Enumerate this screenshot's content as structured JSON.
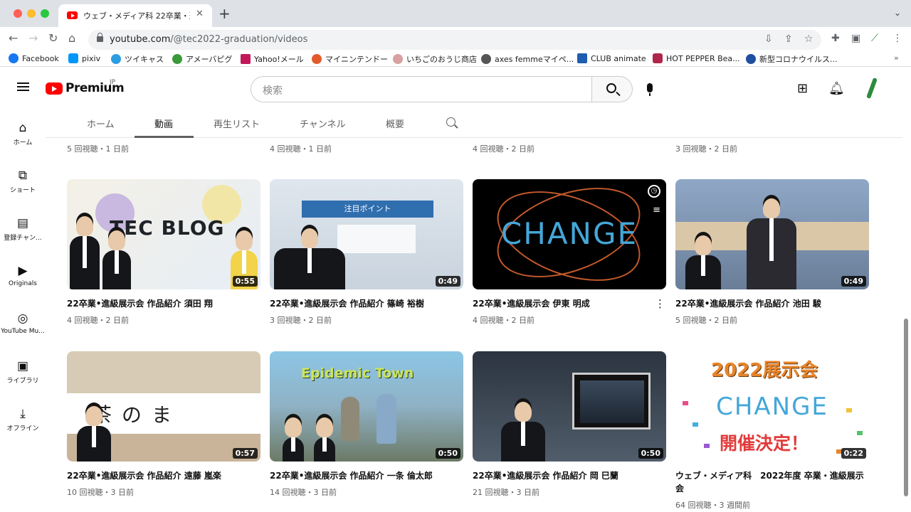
{
  "browser": {
    "tab_title": "ウェブ・メディア科 22卒業・進級",
    "url_host": "youtube.com",
    "url_path": "/@tec2022-graduation/videos",
    "bookmarks": [
      {
        "label": "Facebook",
        "color": "#1877f2"
      },
      {
        "label": "pixiv",
        "color": "#0096fa"
      },
      {
        "label": "ツイキャス",
        "color": "#2d9de3"
      },
      {
        "label": "アメーバピグ",
        "color": "#3a9a3a"
      },
      {
        "label": "Yahoo!メール",
        "color": "#c2185b"
      },
      {
        "label": "マイニンテンドー",
        "color": "#e35a2a"
      },
      {
        "label": "いちごのおうじ商店",
        "color": "#d9a0a0"
      },
      {
        "label": "axes femmeマイペ...",
        "color": "#555555"
      },
      {
        "label": "CLUB animate",
        "color": "#1e5eb0"
      },
      {
        "label": "HOT PEPPER Bea...",
        "color": "#b0264a"
      },
      {
        "label": "新型コロナウイルス...",
        "color": "#1e4fa0"
      }
    ]
  },
  "youtube": {
    "logo_text": "Premium",
    "logo_region": "JP",
    "search_placeholder": "検索",
    "sidebar": [
      {
        "label": "ホーム",
        "icon": "home-icon"
      },
      {
        "label": "ショート",
        "icon": "shorts-icon"
      },
      {
        "label": "登録チャン...",
        "icon": "subscriptions-icon"
      },
      {
        "label": "Originals",
        "icon": "originals-icon"
      },
      {
        "label": "YouTube Mu...",
        "icon": "youtube-music-icon"
      },
      {
        "label": "ライブラリ",
        "icon": "library-icon"
      },
      {
        "label": "オフライン",
        "icon": "download-icon"
      }
    ],
    "channel_tabs": [
      "ホーム",
      "動画",
      "再生リスト",
      "チャンネル",
      "概要"
    ],
    "active_tab": "動画",
    "top_row_meta": [
      "5 回視聴・1 日前",
      "4 回視聴・1 日前",
      "4 回視聴・2 日前",
      "3 回視聴・2 日前"
    ],
    "videos": [
      {
        "title": "22卒業•進級展示会 作品紹介 須田 翔",
        "meta": "4 回視聴・2 日前",
        "duration": "0:55"
      },
      {
        "title": "22卒業•進級展示会 作品紹介 篠崎 裕樹",
        "meta": "3 回視聴・2 日前",
        "duration": "0:49"
      },
      {
        "title": "22卒業•進級展示会 伊東 明成",
        "meta": "4 回視聴・2 日前",
        "duration": ""
      },
      {
        "title": "22卒業•進級展示会 作品紹介 池田 駿",
        "meta": "5 回視聴・2 日前",
        "duration": "0:49"
      },
      {
        "title": "22卒業•進級展示会 作品紹介 遠藤 嵐楽",
        "meta": "10 回視聴・3 日前",
        "duration": "0:57"
      },
      {
        "title": "22卒業•進級展示会 作品紹介 一条 倫太郎",
        "meta": "14 回視聴・3 日前",
        "duration": "0:50"
      },
      {
        "title": "22卒業•進級展示会 作品紹介 岡 巳蘭",
        "meta": "21 回視聴・3 日前",
        "duration": "0:50"
      },
      {
        "title": "ウェブ・メディア科　2022年度 卒業・進級展示会",
        "meta": "64 回視聴・3 週間前",
        "duration": "0:22"
      }
    ],
    "thumb_text": {
      "tec_blog": "TEC BLOG",
      "banner": "注目ポイント",
      "change": "CHANGE",
      "kanji": "茶のま",
      "epidemic": "Epidemic Town",
      "year": "2022展示会",
      "kaisai": "開催決定！"
    }
  }
}
